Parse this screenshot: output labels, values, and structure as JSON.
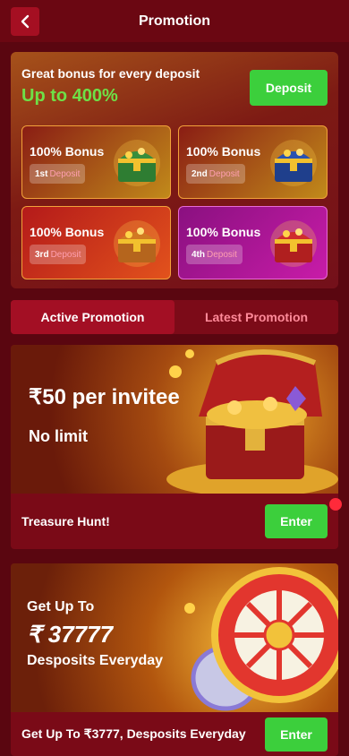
{
  "header": {
    "title": "Promotion"
  },
  "bonus": {
    "title": "Great bonus for every deposit",
    "subtitle": "Up to 400%",
    "deposit_label": "Deposit",
    "tiles": [
      {
        "label": "100% Bonus",
        "ordinal": "1st",
        "deposit": "Deposit"
      },
      {
        "label": "100% Bonus",
        "ordinal": "2nd",
        "deposit": "Deposit"
      },
      {
        "label": "100% Bonus",
        "ordinal": "3rd",
        "deposit": "Deposit"
      },
      {
        "label": "100% Bonus",
        "ordinal": "4th",
        "deposit": "Deposit"
      }
    ]
  },
  "tabs": [
    {
      "label": "Active Promotion"
    },
    {
      "label": "Latest Promotion"
    }
  ],
  "promotions": [
    {
      "banner_line1": "₹50 per invitee",
      "banner_line2": "No limit",
      "title": "Treasure Hunt!",
      "button": "Enter"
    },
    {
      "banner_line1": "Get Up To",
      "banner_line2": "₹ 37777",
      "banner_line3": "Desposits Everyday",
      "title": "Get Up To ₹3777, Desposits Everyday",
      "button": "Enter"
    }
  ],
  "colors": {
    "accent_green": "#3ccf3c",
    "bg": "#5a0610",
    "notification": "#ff2a3a"
  },
  "icons": [
    "chevron-left-icon",
    "treasure-chest-icon",
    "coin-icon",
    "lucky-wheel-icon"
  ]
}
